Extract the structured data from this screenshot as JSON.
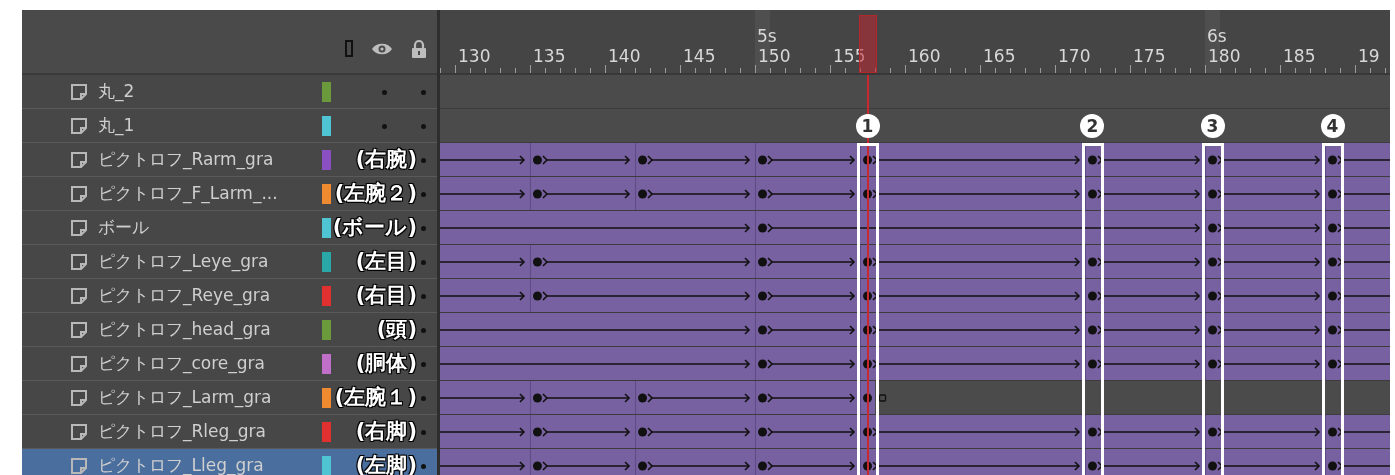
{
  "ruler": {
    "playhead": {
      "level": 0.45
    },
    "seconds": [
      "5s",
      "6s"
    ],
    "frame_labels": [
      "130",
      "135",
      "140",
      "145",
      "150",
      "155",
      "160",
      "165",
      "170",
      "175",
      "180",
      "185",
      "19"
    ]
  },
  "layers": [
    {
      "name": "丸_2",
      "color": "#6b9a3c",
      "eye_dot": true,
      "selected": false
    },
    {
      "name": "丸_1",
      "color": "#4fc4d2",
      "eye_dot": true,
      "selected": false
    },
    {
      "name": "ピクトロフ_Rarm_gra",
      "note": "(右腕)",
      "color": "#8a4fc0",
      "eye_dot": false,
      "selected": false,
      "track": {
        "tween": {
          "level": 1
        },
        "keyframes": [
          {
            "level": 0.1026
          },
          {
            "level": 0.2132
          },
          {
            "level": 0.3395
          },
          {
            "level": 0.45
          },
          {
            "level": 0.6868
          },
          {
            "level": 0.8132
          },
          {
            "level": 0.9395
          }
        ]
      }
    },
    {
      "name": "ピクトロフ_F_Larm_...",
      "note": "(左腕２)",
      "color": "#f08a30",
      "eye_dot": false,
      "selected": false,
      "track": {
        "tween": {
          "level": 1
        },
        "keyframes": [
          {
            "level": 0.1026
          },
          {
            "level": 0.2132
          },
          {
            "level": 0.3395
          },
          {
            "level": 0.45
          },
          {
            "level": 0.6868
          },
          {
            "level": 0.8132
          },
          {
            "level": 0.9395
          }
        ]
      }
    },
    {
      "name": "ボール",
      "note": "(ボール)",
      "color": "#4fc4d2",
      "eye_dot": false,
      "selected": false,
      "track": {
        "tween": {
          "level": 1
        },
        "keyframes": [
          {
            "level": 0.3395
          },
          {
            "level": 0.8132
          },
          {
            "level": 0.9395
          }
        ]
      }
    },
    {
      "name": "ピクトロフ_Leye_gra",
      "note": "(左目)",
      "color": "#2aa8a8",
      "eye_dot": false,
      "selected": false,
      "track": {
        "tween": {
          "level": 1
        },
        "keyframes": [
          {
            "level": 0.1026
          },
          {
            "level": 0.3395
          },
          {
            "level": 0.45
          },
          {
            "level": 0.6868
          },
          {
            "level": 0.8132
          },
          {
            "level": 0.9395
          }
        ]
      }
    },
    {
      "name": "ピクトロフ_Reye_gra",
      "note": "(右目)",
      "color": "#e03030",
      "eye_dot": false,
      "selected": false,
      "track": {
        "tween": {
          "level": 1
        },
        "keyframes": [
          {
            "level": 0.1026
          },
          {
            "level": 0.3395
          },
          {
            "level": 0.45
          },
          {
            "level": 0.6868
          },
          {
            "level": 0.8132
          },
          {
            "level": 0.9395
          }
        ]
      }
    },
    {
      "name": "ピクトロフ_head_gra",
      "note": "(頭)",
      "color": "#6b9a3c",
      "eye_dot": false,
      "selected": false,
      "track": {
        "tween": {
          "level": 1
        },
        "keyframes": [
          {
            "level": 0.3395
          },
          {
            "level": 0.45
          },
          {
            "level": 0.6868
          },
          {
            "level": 0.8132
          },
          {
            "level": 0.9395
          }
        ]
      }
    },
    {
      "name": "ピクトロフ_core_gra",
      "note": "(胴体)",
      "color": "#c070c8",
      "eye_dot": false,
      "selected": false,
      "track": {
        "tween": {
          "level": 1
        },
        "keyframes": [
          {
            "level": 0.3395
          },
          {
            "level": 0.45
          },
          {
            "level": 0.6868
          },
          {
            "level": 0.8132
          },
          {
            "level": 0.9395
          }
        ]
      }
    },
    {
      "name": "ピクトロフ_Larm_gra",
      "note": "(左腕１)",
      "color": "#f08a30",
      "eye_dot": false,
      "selected": false,
      "track": {
        "tween": {
          "level": 0.4579
        },
        "keyframes": [
          {
            "level": 0.1026
          },
          {
            "level": 0.2132
          },
          {
            "level": 0.3395
          },
          {
            "level": 0.45
          }
        ],
        "blank_keyframes": [
          {
            "level": 0.4658
          }
        ]
      }
    },
    {
      "name": "ピクトロフ_Rleg_gra",
      "note": "(右脚)",
      "color": "#e03030",
      "eye_dot": false,
      "selected": false,
      "track": {
        "tween": {
          "level": 1
        },
        "keyframes": [
          {
            "level": 0.1026
          },
          {
            "level": 0.2132
          },
          {
            "level": 0.3395
          },
          {
            "level": 0.45
          },
          {
            "level": 0.6868
          },
          {
            "level": 0.8132
          },
          {
            "level": 0.9395
          }
        ]
      }
    },
    {
      "name": "ピクトロフ_Lleg_gra",
      "note": "(左脚)",
      "color": "#4fc4d2",
      "eye_dot": false,
      "selected": true,
      "track": {
        "tween": {
          "level": 1
        },
        "keyframes": [
          {
            "level": 0.1026
          },
          {
            "level": 0.2132
          },
          {
            "level": 0.3395
          },
          {
            "level": 0.45
          },
          {
            "level": 0.6868
          },
          {
            "level": 0.8132
          },
          {
            "level": 0.9395
          }
        ]
      }
    }
  ],
  "callouts": [
    {
      "number": "1",
      "level": 0.45
    },
    {
      "number": "2",
      "level": 0.6868
    },
    {
      "number": "3",
      "level": 0.8132
    },
    {
      "number": "4",
      "level": 0.9395
    }
  ]
}
